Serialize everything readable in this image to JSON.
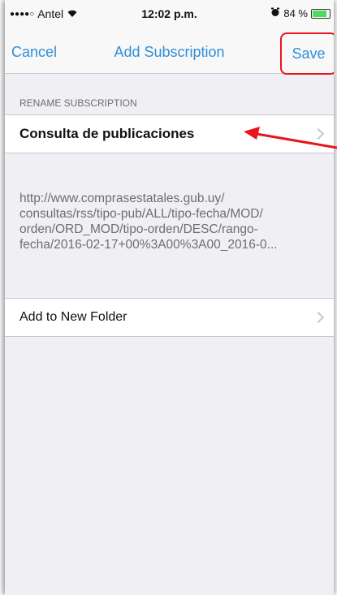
{
  "status_bar": {
    "carrier": "Antel",
    "time": "12:02 p.m.",
    "battery_percent": "84 %",
    "battery_level": 0.84
  },
  "nav": {
    "cancel_label": "Cancel",
    "title": "Add Subscription",
    "save_label": "Save"
  },
  "section": {
    "header": "RENAME SUBSCRIPTION",
    "name_value": "Consulta de publicaciones"
  },
  "url": {
    "lines": [
      "http://www.comprasestatales.gub.uy/",
      "consultas/rss/tipo-pub/ALL/tipo-fecha/MOD/",
      "orden/ORD_MOD/tipo-orden/DESC/rango-",
      "fecha/2016-02-17+00%3A00%3A00_2016-0..."
    ]
  },
  "folder": {
    "label": "Add to New Folder"
  },
  "colors": {
    "accent": "#2f8fd8",
    "annotation": "#e8141e"
  }
}
